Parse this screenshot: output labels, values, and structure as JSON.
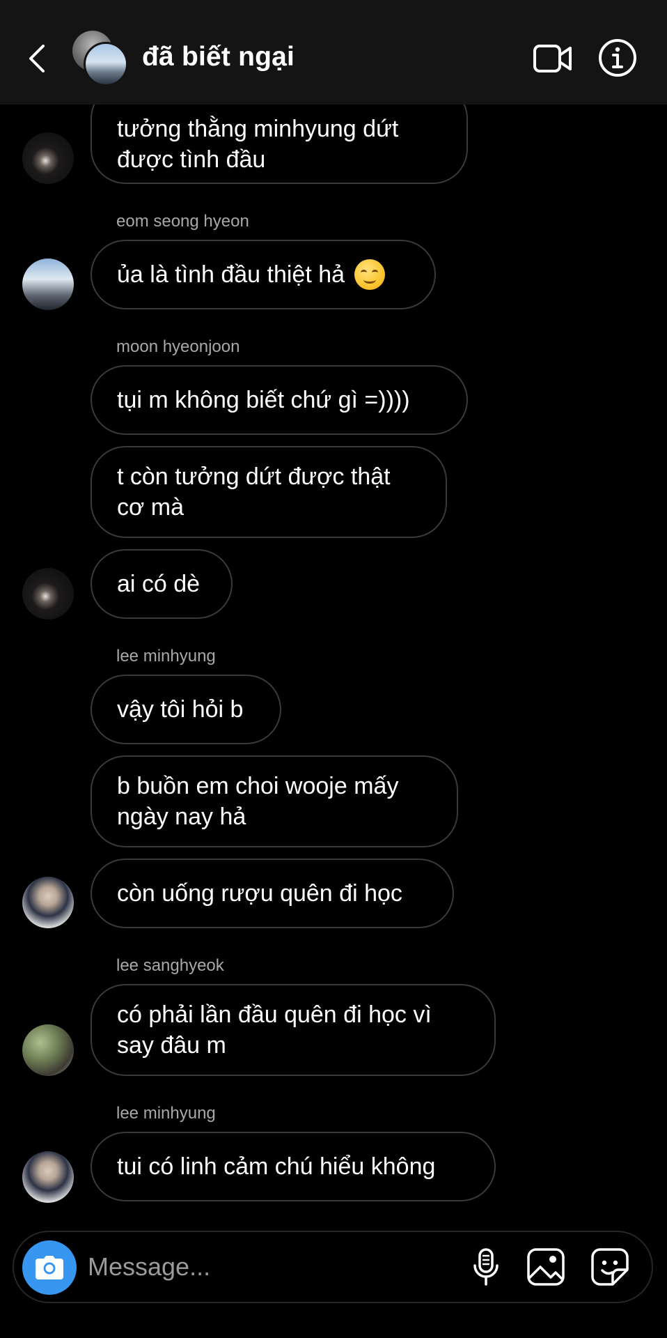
{
  "colors": {
    "header_bg": "#141414",
    "bubble_border": "#3a3a3a",
    "sender_text": "#a8a8a8",
    "camera_button": "#3797f0",
    "placeholder": "#9a9a9a"
  },
  "header": {
    "back_icon": "chevron-left-icon",
    "title": "đã biết ngại",
    "video_icon": "video-camera-icon",
    "info_icon": "info-icon"
  },
  "messages": [
    {
      "lines": [
        "tưởng thằng minhyung dứt",
        "được tình đầu"
      ]
    },
    {
      "sender": "eom seong hyeon",
      "text": "ủa là tình đầu thiệt hả",
      "emoji": "smiling-face-emoji"
    },
    {
      "sender": "moon hyeonjoon",
      "text": "tụi m không biết chứ gì =))))"
    },
    {
      "lines": [
        "t còn tưởng dứt được thật",
        "cơ mà"
      ]
    },
    {
      "text": "ai có dè"
    },
    {
      "sender": "lee minhyung",
      "text": "vậy tôi hỏi b"
    },
    {
      "lines": [
        "b buồn em choi wooje mấy",
        "ngày nay hả"
      ]
    },
    {
      "text": "còn uống rượu quên đi học"
    },
    {
      "sender": "lee sanghyeok",
      "lines": [
        "có phải lần đầu quên đi học vì",
        "say đâu m"
      ]
    },
    {
      "sender": "lee minhyung",
      "text": "tui có linh cảm chú hiểu không"
    }
  ],
  "composer": {
    "placeholder": "Message...",
    "value": "",
    "camera_icon": "camera-icon",
    "mic_icon": "microphone-icon",
    "gallery_icon": "image-gallery-icon",
    "sticker_icon": "sticker-icon"
  }
}
